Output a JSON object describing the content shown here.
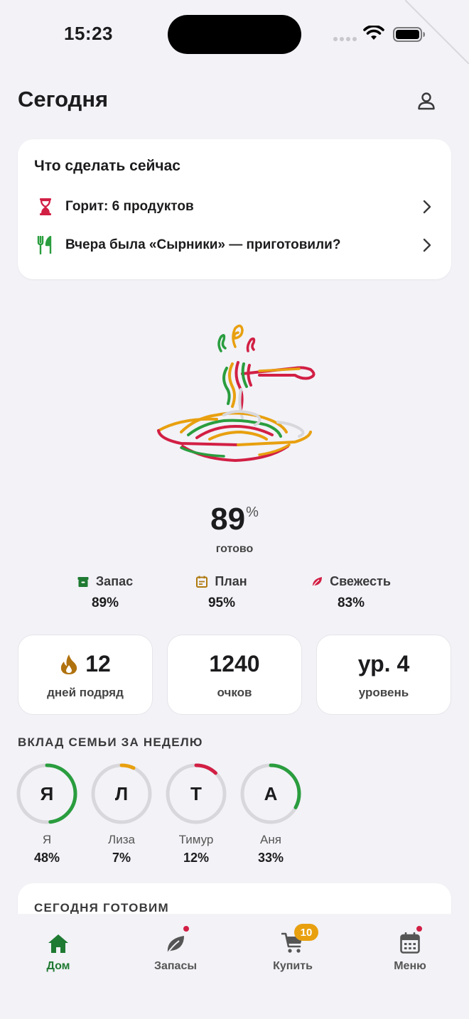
{
  "status_bar": {
    "time": "15:23"
  },
  "header": {
    "title": "Сегодня"
  },
  "action_card": {
    "title": "Что сделать сейчас",
    "items": [
      {
        "label": "Горит: 6 продуктов",
        "icon": "hourglass-icon"
      },
      {
        "label": "Вчера была «Сырники» — приготовили?",
        "icon": "utensils-icon"
      }
    ]
  },
  "readiness": {
    "value": "89",
    "unit": "%",
    "label": "готово",
    "metrics": [
      {
        "label": "Запас",
        "value": "89%",
        "icon": "box-icon",
        "color": "#1f7a32"
      },
      {
        "label": "План",
        "value": "95%",
        "icon": "calendar-icon",
        "color": "#b07a10"
      },
      {
        "label": "Свежесть",
        "value": "83%",
        "icon": "leaf-icon",
        "color": "#d21f44"
      }
    ]
  },
  "stats": [
    {
      "value": "12",
      "label": "дней подряд",
      "icon": "flame-icon"
    },
    {
      "value": "1240",
      "label": "очков"
    },
    {
      "value": "ур. 4",
      "label": "уровень"
    }
  ],
  "family": {
    "title": "ВКЛАД СЕМЬИ ЗА НЕДЕЛЮ",
    "members": [
      {
        "initial": "Я",
        "name": "Я",
        "percent": "48%",
        "share": 0.48,
        "color": "#2a9d3e"
      },
      {
        "initial": "Л",
        "name": "Лиза",
        "percent": "7%",
        "share": 0.07,
        "color": "#e8a00f"
      },
      {
        "initial": "Т",
        "name": "Тимур",
        "percent": "12%",
        "share": 0.12,
        "color": "#d21f44"
      },
      {
        "initial": "А",
        "name": "Аня",
        "percent": "33%",
        "share": 0.33,
        "color": "#2a9d3e"
      }
    ]
  },
  "cooking": {
    "title": "СЕГОДНЯ ГОТОВИМ"
  },
  "tab_bar": {
    "tabs": [
      {
        "label": "Дом",
        "icon": "home-icon",
        "active": true
      },
      {
        "label": "Запасы",
        "icon": "leaf-icon",
        "dot": true
      },
      {
        "label": "Купить",
        "icon": "cart-icon",
        "badge": "10"
      },
      {
        "label": "Меню",
        "icon": "calendar-icon",
        "dot": true
      }
    ]
  },
  "colors": {
    "accent_green": "#1f7a32",
    "accent_orange": "#e8a00f",
    "accent_red": "#d21f44",
    "background": "#f2f2f7",
    "card": "#ffffff"
  }
}
